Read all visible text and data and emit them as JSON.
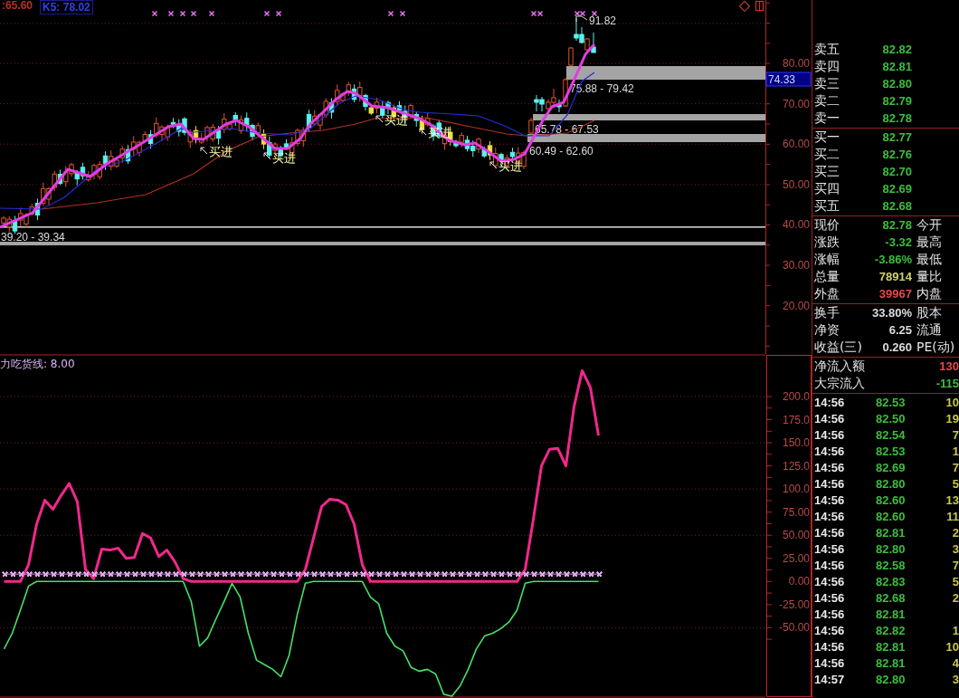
{
  "price_chart": {
    "legend": [
      {
        "text": ":65.60",
        "color": "#b83020",
        "selected": false
      },
      {
        "text": "K5: 78.02",
        "color": "#3040f0",
        "selected": true
      }
    ],
    "axis_labels": [
      "80.00",
      "70.00",
      "60.00",
      "50.00",
      "40.00",
      "30.00",
      "20.00"
    ],
    "cursor_price": "74.33",
    "high_label": "91.82",
    "zones": [
      {
        "label": "75.88 - 79.42"
      },
      {
        "label": "65.78 - 67.53"
      },
      {
        "label": "60.49 - 62.60"
      },
      {
        "label": "39.20 - 39.34"
      }
    ],
    "signals": [
      {
        "label": "买进"
      },
      {
        "label": "买进"
      },
      {
        "label": "买进"
      },
      {
        "label": "买进"
      },
      {
        "label": "买进"
      }
    ]
  },
  "indicator_chart": {
    "title": "力吃货线: 8.00",
    "chart_data": {
      "type": "line",
      "grid": true,
      "categories": [
        null,
        null,
        null,
        null,
        null,
        null,
        null,
        null,
        null,
        null,
        null,
        null,
        null,
        null,
        null,
        null,
        null,
        null,
        null,
        null,
        null,
        null,
        null,
        null,
        null,
        null,
        null,
        null,
        null,
        null,
        null,
        null,
        null,
        null,
        null,
        null,
        null,
        null,
        null,
        null,
        null,
        null,
        null,
        null,
        null,
        null,
        null,
        null,
        null,
        null,
        null,
        null,
        null,
        null,
        null,
        null,
        null,
        null,
        null,
        null,
        null,
        null,
        null,
        null,
        null,
        null,
        null,
        null,
        null,
        null,
        null,
        null,
        null,
        null,
        null,
        null,
        null,
        null,
        null,
        null,
        null,
        null,
        null,
        null,
        null,
        null,
        null,
        null,
        null,
        null,
        null,
        null,
        null,
        null
      ],
      "ylim": [
        -125,
        245
      ],
      "yticks": [
        {
          "value": 200,
          "label": "200.0"
        },
        {
          "value": 175,
          "label": "175.0"
        },
        {
          "value": 150,
          "label": "150.0"
        },
        {
          "value": 125,
          "label": "125.0"
        },
        {
          "value": 100,
          "label": "100.0"
        },
        {
          "value": 75,
          "label": "75.00"
        },
        {
          "value": 50,
          "label": "50.00"
        },
        {
          "value": 25,
          "label": "25.00"
        },
        {
          "value": 0,
          "label": "0.00"
        },
        {
          "value": -25,
          "label": "-25.00"
        },
        {
          "value": -50,
          "label": "-50.00"
        }
      ],
      "series": [
        {
          "color": "#e0a8ec",
          "marker": "x",
          "values": [
            8,
            8,
            8,
            8,
            8,
            8,
            8,
            8,
            8,
            8,
            8,
            8,
            8,
            8,
            8,
            8,
            8,
            8,
            8,
            8,
            8,
            8,
            8,
            8,
            8,
            8,
            8,
            8,
            8,
            8,
            8,
            8,
            8,
            8,
            8,
            8,
            8,
            8,
            8,
            8,
            8,
            8,
            8,
            8,
            8,
            8,
            8,
            8,
            8,
            8,
            8,
            8,
            8,
            8,
            8,
            8,
            8,
            8,
            8,
            8,
            8,
            8,
            8,
            8,
            8,
            8,
            8,
            8,
            8,
            8,
            8,
            8,
            8,
            8,
            null,
            null,
            null,
            null,
            null,
            null,
            null,
            null,
            null,
            null,
            null,
            null,
            null,
            null,
            null,
            null,
            null,
            null,
            null,
            null
          ]
        },
        {
          "color": "#f0288c",
          "values": [
            0,
            0,
            0,
            18,
            62,
            88,
            78,
            93,
            106,
            86,
            13,
            3,
            35,
            34,
            36,
            25,
            26,
            52,
            47,
            27,
            34,
            21,
            3,
            0,
            0,
            0,
            0,
            0,
            0,
            0,
            0,
            0,
            0,
            0,
            0,
            0,
            0,
            13,
            47,
            81,
            89,
            88,
            83,
            62,
            18,
            0,
            0,
            0,
            0,
            0,
            0,
            0,
            0,
            0,
            0,
            0,
            0,
            0,
            0,
            0,
            0,
            0,
            0,
            0,
            13,
            67,
            125,
            143,
            144,
            125,
            189,
            228,
            210,
            158,
            null,
            null,
            null,
            null,
            null,
            null,
            null,
            null,
            null,
            null,
            null,
            null,
            null,
            null,
            null,
            null,
            null,
            null,
            null,
            null
          ]
        },
        {
          "color": "#46e066",
          "values": [
            -73,
            -56,
            -31,
            -5,
            0,
            0,
            0,
            0,
            0,
            0,
            0,
            0,
            0,
            0,
            0,
            0,
            0,
            0,
            0,
            0,
            0,
            0,
            0,
            -22,
            -70,
            -61,
            -41,
            -22,
            -2,
            -17,
            -56,
            -85,
            -90,
            -95,
            -103,
            -80,
            -36,
            -2,
            0,
            0,
            0,
            0,
            0,
            0,
            0,
            -17,
            -24,
            -56,
            -70,
            -75,
            -93,
            -97,
            -95,
            -100,
            -122,
            -124,
            -113,
            -95,
            -73,
            -59,
            -56,
            -51,
            -44,
            -31,
            -2,
            0,
            0,
            0,
            0,
            0,
            0,
            0,
            0,
            0,
            null,
            null,
            null,
            null,
            null,
            null,
            null,
            null,
            null,
            null,
            null,
            null,
            null,
            null,
            null,
            null,
            null,
            null,
            null,
            null
          ]
        }
      ]
    }
  },
  "quote_panel": {
    "asks": [
      {
        "label": "卖五",
        "price": "82.82"
      },
      {
        "label": "卖四",
        "price": "82.81"
      },
      {
        "label": "卖三",
        "price": "82.80"
      },
      {
        "label": "卖二",
        "price": "82.79"
      },
      {
        "label": "卖一",
        "price": "82.78"
      }
    ],
    "bids": [
      {
        "label": "买一",
        "price": "82.77"
      },
      {
        "label": "买二",
        "price": "82.76"
      },
      {
        "label": "买三",
        "price": "82.70"
      },
      {
        "label": "买四",
        "price": "82.69"
      },
      {
        "label": "买五",
        "price": "82.68"
      }
    ],
    "stats": [
      {
        "label": "现价",
        "value": "82.78",
        "color": "#3cbe3c",
        "side_label": "今开"
      },
      {
        "label": "涨跌",
        "value": "-3.32",
        "color": "#3cbe3c",
        "side_label": "最高"
      },
      {
        "label": "涨幅",
        "value": "-3.86%",
        "color": "#3cbe3c",
        "side_label": "最低"
      },
      {
        "label": "总量",
        "value": "78914",
        "color": "#d2d264",
        "side_label": "量比"
      },
      {
        "label": "外盘",
        "value": "39967",
        "color": "#e84848",
        "side_label": "内盘"
      }
    ],
    "ratios": [
      {
        "label": "换手",
        "value": "33.80%",
        "side_label": "股本"
      },
      {
        "label": "净资",
        "value": "6.25",
        "side_label": "流通"
      },
      {
        "label": "收益(三)",
        "value": "0.260",
        "side_label": "PE(动)"
      }
    ],
    "flows": [
      {
        "label": "净流入额",
        "value": "130",
        "color": "#e84848"
      },
      {
        "label": "大宗流入",
        "value": "-115",
        "color": "#3cbe3c"
      }
    ],
    "ticks": [
      {
        "time": "14:56",
        "price": "82.53",
        "volume": "10"
      },
      {
        "time": "14:56",
        "price": "82.50",
        "volume": "19"
      },
      {
        "time": "14:56",
        "price": "82.54",
        "volume": "7"
      },
      {
        "time": "14:56",
        "price": "82.53",
        "volume": "1"
      },
      {
        "time": "14:56",
        "price": "82.69",
        "volume": "7"
      },
      {
        "time": "14:56",
        "price": "82.80",
        "volume": "5"
      },
      {
        "time": "14:56",
        "price": "82.60",
        "volume": "13"
      },
      {
        "time": "14:56",
        "price": "82.60",
        "volume": "11"
      },
      {
        "time": "14:56",
        "price": "82.81",
        "volume": "2"
      },
      {
        "time": "14:56",
        "price": "82.80",
        "volume": "3"
      },
      {
        "time": "14:56",
        "price": "82.58",
        "volume": "7"
      },
      {
        "time": "14:56",
        "price": "82.83",
        "volume": "5"
      },
      {
        "time": "14:56",
        "price": "82.68",
        "volume": "2"
      },
      {
        "time": "14:56",
        "price": "82.81"
      },
      {
        "time": "14:56",
        "price": "82.82",
        "volume": "1"
      },
      {
        "time": "14:56",
        "price": "82.81",
        "volume": "10"
      },
      {
        "time": "14:56",
        "price": "82.81",
        "volume": "4"
      },
      {
        "time": "14:57",
        "price": "82.80",
        "volume": "3"
      }
    ]
  }
}
